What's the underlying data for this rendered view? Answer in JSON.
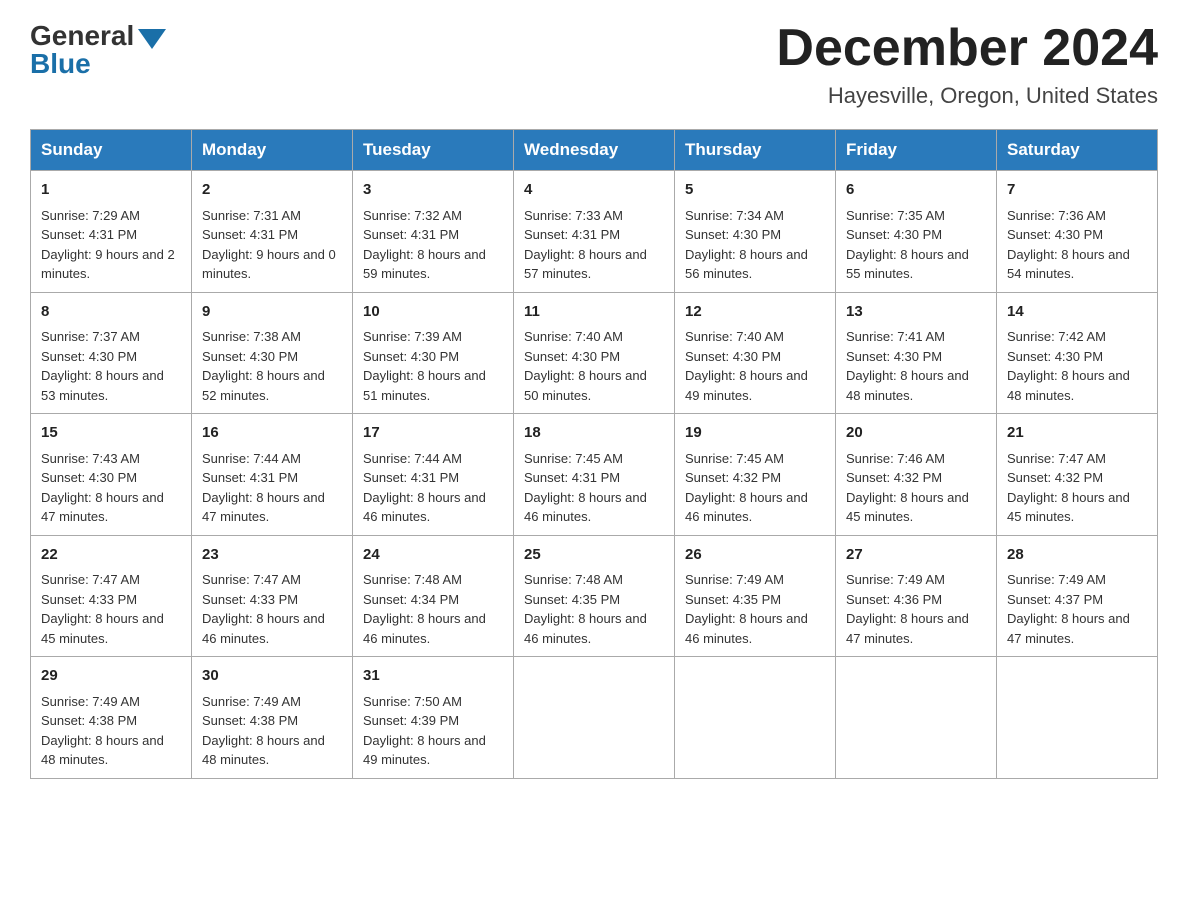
{
  "header": {
    "logo_text1": "General",
    "logo_text2": "Blue",
    "month_title": "December 2024",
    "location": "Hayesville, Oregon, United States"
  },
  "weekdays": [
    "Sunday",
    "Monday",
    "Tuesday",
    "Wednesday",
    "Thursday",
    "Friday",
    "Saturday"
  ],
  "weeks": [
    [
      {
        "day": "1",
        "sunrise": "7:29 AM",
        "sunset": "4:31 PM",
        "daylight": "9 hours and 2 minutes."
      },
      {
        "day": "2",
        "sunrise": "7:31 AM",
        "sunset": "4:31 PM",
        "daylight": "9 hours and 0 minutes."
      },
      {
        "day": "3",
        "sunrise": "7:32 AM",
        "sunset": "4:31 PM",
        "daylight": "8 hours and 59 minutes."
      },
      {
        "day": "4",
        "sunrise": "7:33 AM",
        "sunset": "4:31 PM",
        "daylight": "8 hours and 57 minutes."
      },
      {
        "day": "5",
        "sunrise": "7:34 AM",
        "sunset": "4:30 PM",
        "daylight": "8 hours and 56 minutes."
      },
      {
        "day": "6",
        "sunrise": "7:35 AM",
        "sunset": "4:30 PM",
        "daylight": "8 hours and 55 minutes."
      },
      {
        "day": "7",
        "sunrise": "7:36 AM",
        "sunset": "4:30 PM",
        "daylight": "8 hours and 54 minutes."
      }
    ],
    [
      {
        "day": "8",
        "sunrise": "7:37 AM",
        "sunset": "4:30 PM",
        "daylight": "8 hours and 53 minutes."
      },
      {
        "day": "9",
        "sunrise": "7:38 AM",
        "sunset": "4:30 PM",
        "daylight": "8 hours and 52 minutes."
      },
      {
        "day": "10",
        "sunrise": "7:39 AM",
        "sunset": "4:30 PM",
        "daylight": "8 hours and 51 minutes."
      },
      {
        "day": "11",
        "sunrise": "7:40 AM",
        "sunset": "4:30 PM",
        "daylight": "8 hours and 50 minutes."
      },
      {
        "day": "12",
        "sunrise": "7:40 AM",
        "sunset": "4:30 PM",
        "daylight": "8 hours and 49 minutes."
      },
      {
        "day": "13",
        "sunrise": "7:41 AM",
        "sunset": "4:30 PM",
        "daylight": "8 hours and 48 minutes."
      },
      {
        "day": "14",
        "sunrise": "7:42 AM",
        "sunset": "4:30 PM",
        "daylight": "8 hours and 48 minutes."
      }
    ],
    [
      {
        "day": "15",
        "sunrise": "7:43 AM",
        "sunset": "4:30 PM",
        "daylight": "8 hours and 47 minutes."
      },
      {
        "day": "16",
        "sunrise": "7:44 AM",
        "sunset": "4:31 PM",
        "daylight": "8 hours and 47 minutes."
      },
      {
        "day": "17",
        "sunrise": "7:44 AM",
        "sunset": "4:31 PM",
        "daylight": "8 hours and 46 minutes."
      },
      {
        "day": "18",
        "sunrise": "7:45 AM",
        "sunset": "4:31 PM",
        "daylight": "8 hours and 46 minutes."
      },
      {
        "day": "19",
        "sunrise": "7:45 AM",
        "sunset": "4:32 PM",
        "daylight": "8 hours and 46 minutes."
      },
      {
        "day": "20",
        "sunrise": "7:46 AM",
        "sunset": "4:32 PM",
        "daylight": "8 hours and 45 minutes."
      },
      {
        "day": "21",
        "sunrise": "7:47 AM",
        "sunset": "4:32 PM",
        "daylight": "8 hours and 45 minutes."
      }
    ],
    [
      {
        "day": "22",
        "sunrise": "7:47 AM",
        "sunset": "4:33 PM",
        "daylight": "8 hours and 45 minutes."
      },
      {
        "day": "23",
        "sunrise": "7:47 AM",
        "sunset": "4:33 PM",
        "daylight": "8 hours and 46 minutes."
      },
      {
        "day": "24",
        "sunrise": "7:48 AM",
        "sunset": "4:34 PM",
        "daylight": "8 hours and 46 minutes."
      },
      {
        "day": "25",
        "sunrise": "7:48 AM",
        "sunset": "4:35 PM",
        "daylight": "8 hours and 46 minutes."
      },
      {
        "day": "26",
        "sunrise": "7:49 AM",
        "sunset": "4:35 PM",
        "daylight": "8 hours and 46 minutes."
      },
      {
        "day": "27",
        "sunrise": "7:49 AM",
        "sunset": "4:36 PM",
        "daylight": "8 hours and 47 minutes."
      },
      {
        "day": "28",
        "sunrise": "7:49 AM",
        "sunset": "4:37 PM",
        "daylight": "8 hours and 47 minutes."
      }
    ],
    [
      {
        "day": "29",
        "sunrise": "7:49 AM",
        "sunset": "4:38 PM",
        "daylight": "8 hours and 48 minutes."
      },
      {
        "day": "30",
        "sunrise": "7:49 AM",
        "sunset": "4:38 PM",
        "daylight": "8 hours and 48 minutes."
      },
      {
        "day": "31",
        "sunrise": "7:50 AM",
        "sunset": "4:39 PM",
        "daylight": "8 hours and 49 minutes."
      },
      null,
      null,
      null,
      null
    ]
  ]
}
